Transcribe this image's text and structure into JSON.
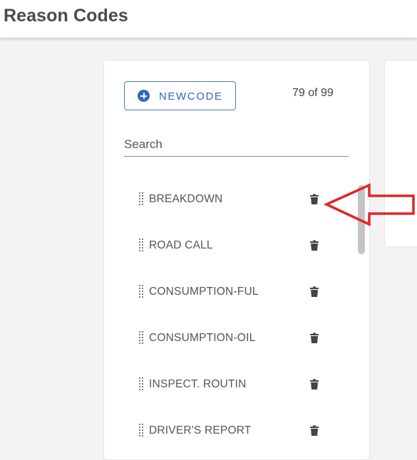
{
  "header": {
    "title": "Reason Codes"
  },
  "toolbar": {
    "new_code_label": "NEWCODE",
    "count": "79 of 99"
  },
  "search": {
    "placeholder": "Search"
  },
  "list": {
    "items": [
      {
        "label": "BREAKDOWN"
      },
      {
        "label": "ROAD CALL"
      },
      {
        "label": "CONSUMPTION-FUL"
      },
      {
        "label": "CONSUMPTION-OIL"
      },
      {
        "label": "INSPECT. ROUTIN"
      },
      {
        "label": "DRIVER'S REPORT"
      }
    ]
  },
  "icons": {
    "new": "plus-circle-icon",
    "drag": "drag-handle-icon",
    "delete": "trash-icon",
    "annotation": "red-arrow-icon"
  },
  "colors": {
    "accent": "#2f66c4",
    "annotation": "#e0262a"
  }
}
